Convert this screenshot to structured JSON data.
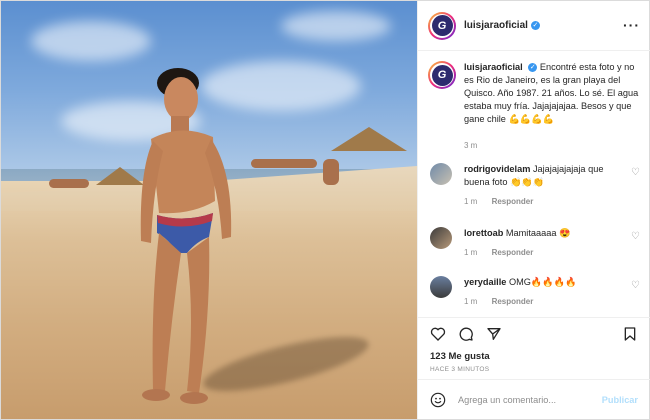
{
  "post": {
    "username": "luisjaraoficial",
    "caption": "Encontré esta foto y no es Rio de Janeiro, es la gran playa del Quisco. Año 1987. 21 años. Lo sé. El agua estaba muy fría. Jajajajajaa. Besos y que gane chile 💪💪💪💪",
    "caption_time": "3 m",
    "likes": "123 Me gusta",
    "posted_ago": "HACE 3 MINUTOS"
  },
  "comments": [
    {
      "user": "rodrigovidelam",
      "text": "Jajajajajajaja que buena foto 👏👏👏",
      "time": "1 m",
      "reply": "Responder"
    },
    {
      "user": "lorettoab",
      "text": "Mamitaaaaa 😍",
      "time": "1 m",
      "reply": "Responder"
    },
    {
      "user": "yerydaille",
      "text": "OMG🔥🔥🔥🔥",
      "time": "1 m",
      "reply": "Responder"
    }
  ],
  "add_comment": {
    "placeholder": "Agrega un comentario...",
    "post_label": "Publicar"
  },
  "colors": {
    "verified": "#3897f0",
    "muted": "#8e8e8e",
    "link_disabled": "#b2dffc"
  }
}
